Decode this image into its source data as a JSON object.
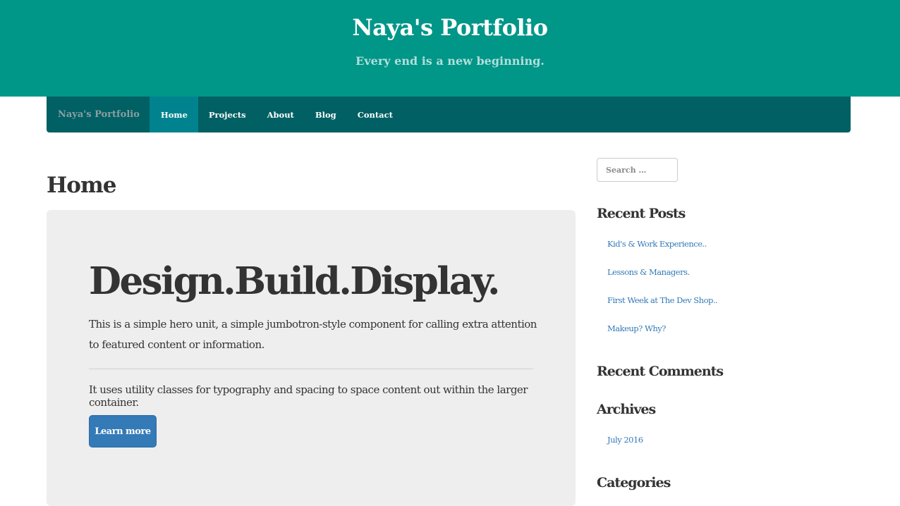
{
  "header": {
    "title": "Naya's Portfolio",
    "tagline": "Every end is a new beginning.",
    "background_color": "#009688"
  },
  "navbar": {
    "brand": "Naya's Portfolio",
    "items": [
      {
        "label": "Home",
        "active": true
      },
      {
        "label": "Projects",
        "active": false
      },
      {
        "label": "About",
        "active": false
      },
      {
        "label": "Blog",
        "active": false
      },
      {
        "label": "Contact",
        "active": false
      }
    ],
    "background_color": "#006064",
    "active_color": "#00838f"
  },
  "main": {
    "page_title": "Home",
    "jumbotron": {
      "heading": "Design.Build.Display.",
      "lead": "This is a simple hero unit, a simple jumbotron-style component for calling extra attention to featured content or information.",
      "text": "It uses utility classes for typography and spacing to space content out within the larger container.",
      "button_label": "Learn more"
    }
  },
  "sidebar": {
    "search_placeholder": "Search …",
    "recent_posts_title": "Recent Posts",
    "recent_posts": [
      "Kid's & Work Experience..",
      "Lessons & Managers.",
      "First Week at The Dev Shop..",
      "Makeup? Why?"
    ],
    "recent_comments_title": "Recent Comments",
    "archives_title": "Archives",
    "archives": [
      "July 2016"
    ],
    "categories_title": "Categories"
  }
}
